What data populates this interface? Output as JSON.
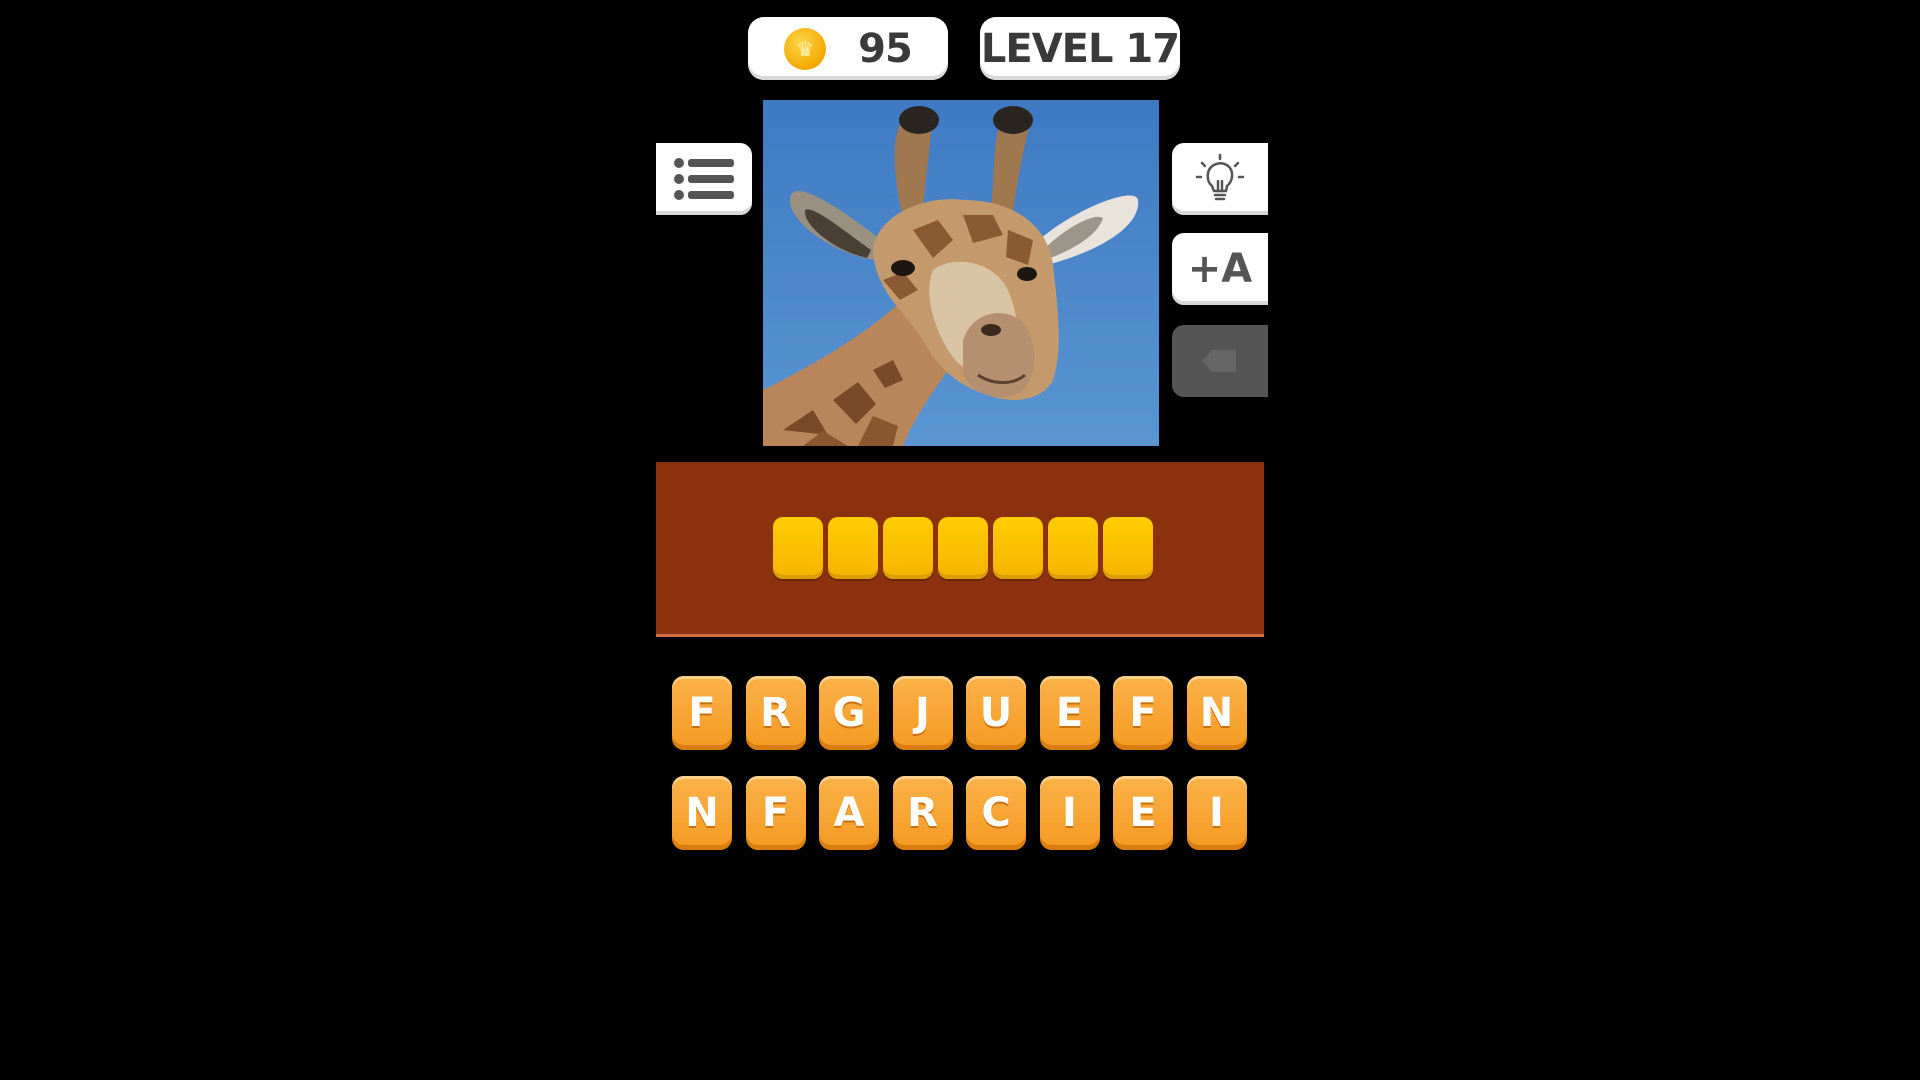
{
  "header": {
    "coins": "95",
    "level": "LEVEL 17"
  },
  "side_buttons": {
    "menu_icon": "list-icon",
    "hint_icon": "lightbulb-icon",
    "add_letter_label": "+A",
    "disabled_icon": "remove-letter-icon"
  },
  "puzzle": {
    "image_icon": "giraffe-photo",
    "answer_length": 7
  },
  "keyboard": {
    "row1": [
      "F",
      "R",
      "G",
      "J",
      "U",
      "E",
      "F",
      "N"
    ],
    "row2": [
      "N",
      "F",
      "A",
      "R",
      "C",
      "I",
      "E",
      "I"
    ]
  },
  "colors": {
    "answer_panel": "#8b310e",
    "slot": "#ffcc00",
    "key": "#f7a530",
    "sky": "#4a84c8"
  }
}
